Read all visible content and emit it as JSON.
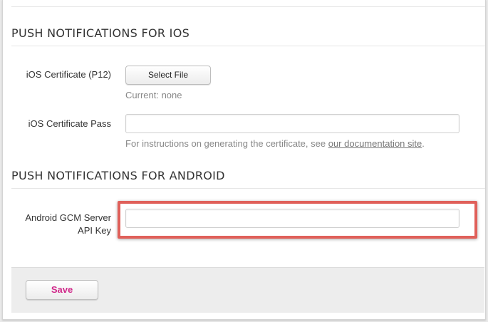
{
  "ios_section": {
    "title": "PUSH NOTIFICATIONS FOR IOS",
    "certificate_label": "iOS Certificate (P12)",
    "select_file_label": "Select File",
    "current_text": "Current: none",
    "pass_label": "iOS Certificate Pass",
    "pass_value": "",
    "help_prefix": "For instructions on generating the certificate, see ",
    "help_link": "our documentation site",
    "help_suffix": "."
  },
  "android_section": {
    "title": "PUSH NOTIFICATIONS FOR ANDROID",
    "gcm_label_line1": "Android GCM Server",
    "gcm_label_line2": "API Key",
    "gcm_value": ""
  },
  "footer": {
    "save_label": "Save"
  },
  "colors": {
    "highlight": "#e0605a",
    "save_text": "#d0298a"
  }
}
